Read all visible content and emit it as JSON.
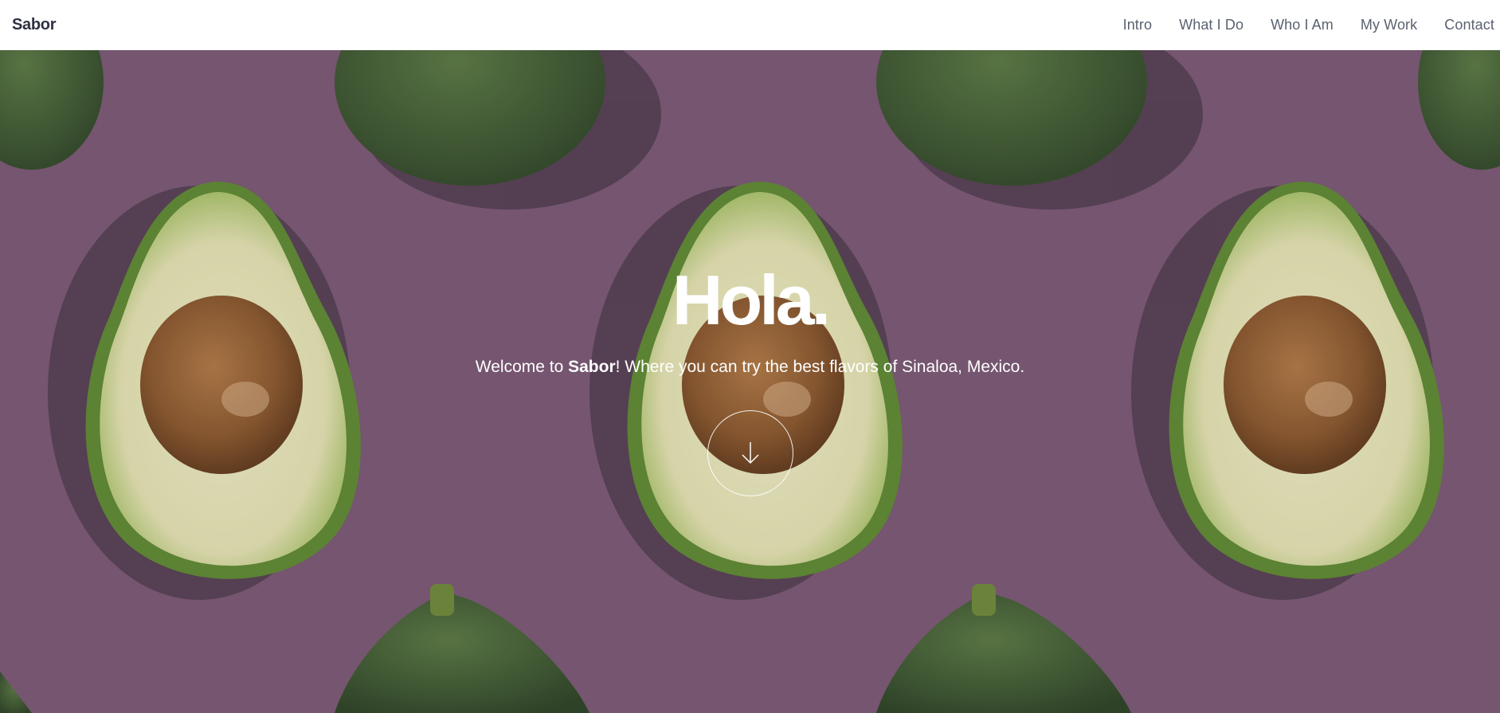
{
  "header": {
    "brand": "Sabor",
    "nav": [
      "Intro",
      "What I Do",
      "Who I Am",
      "My Work",
      "Contact"
    ]
  },
  "hero": {
    "title": "Hola.",
    "subtitle_prefix": "Welcome to ",
    "subtitle_brand": "Sabor",
    "subtitle_suffix": "! Where you can try the best flavors of Sinaloa, Mexico.",
    "scroll_icon": "arrow-down-icon"
  },
  "colors": {
    "background_purple": "#7a5a74",
    "avocado_skin": "#3f5f33",
    "avocado_flesh": "#e8e6b8",
    "avocado_pit": "#8a5a2e",
    "header_bg": "#ffffff",
    "text_dark": "#2e3141",
    "text_light": "#ffffff"
  }
}
